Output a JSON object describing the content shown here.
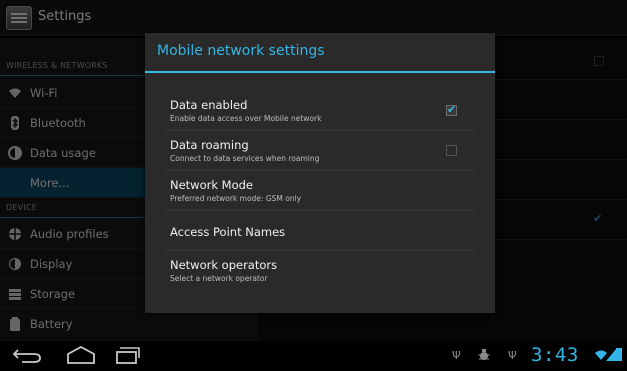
{
  "app": {
    "title": "Settings",
    "icon": "settings-icon"
  },
  "sidebar": {
    "sections": [
      {
        "header": "WIRELESS & NETWORKS"
      },
      {
        "header": "DEVICE"
      }
    ],
    "items": [
      {
        "label": "Wi-Fi",
        "icon": "wifi-icon"
      },
      {
        "label": "Bluetooth",
        "icon": "bluetooth-icon"
      },
      {
        "label": "Data usage",
        "icon": "data-usage-icon"
      },
      {
        "label": "More...",
        "icon": "",
        "selected": true
      },
      {
        "label": "Audio profiles",
        "icon": "audio-profiles-icon"
      },
      {
        "label": "Display",
        "icon": "display-icon"
      },
      {
        "label": "Storage",
        "icon": "storage-icon"
      },
      {
        "label": "Battery",
        "icon": "battery-icon"
      }
    ]
  },
  "dialog": {
    "title": "Mobile network settings",
    "options": [
      {
        "title": "Data enabled",
        "summary": "Enable data access over Mobile network",
        "checked": true
      },
      {
        "title": "Data roaming",
        "summary": "Connect to data services when roaming",
        "checked": false
      },
      {
        "title": "Network Mode",
        "summary": "Preferred network mode: GSM only"
      },
      {
        "title": "Access Point Names",
        "summary": ""
      },
      {
        "title": "Network operators",
        "summary": "Select a network operator"
      }
    ]
  },
  "statusbar": {
    "time": "3:43",
    "accent": "#33b5e5",
    "icons": [
      "usb-icon",
      "debug-icon",
      "usb-icon",
      "wifi-icon",
      "signal-icon",
      "battery-icon"
    ]
  },
  "navbar": {
    "buttons": [
      "back-icon",
      "home-icon",
      "recents-icon"
    ]
  }
}
